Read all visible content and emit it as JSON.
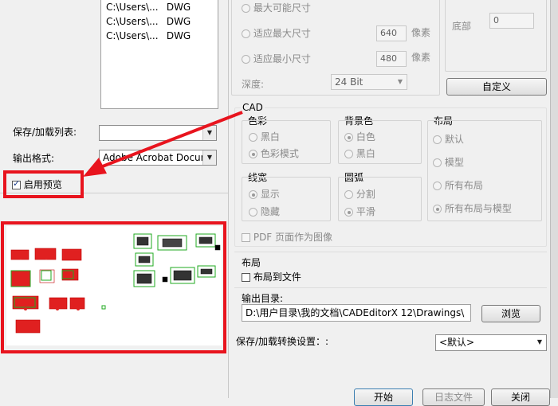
{
  "file_list": [
    {
      "path": "C:\\Users\\...",
      "type": "DWG"
    },
    {
      "path": "C:\\Users\\...",
      "type": "DWG"
    },
    {
      "path": "C:\\Users\\...",
      "type": "DWG"
    }
  ],
  "left": {
    "save_load_list_label": "保存/加载列表:",
    "save_load_list_value": "",
    "output_format_label": "输出格式:",
    "output_format_value": "Adobe Acrobat Document",
    "enable_preview_label": "启用预览",
    "enable_preview_checked": true
  },
  "size_options": {
    "max_possible": "最大可能尺寸",
    "fit_max": "适应最大尺寸",
    "fit_max_value": "640",
    "fit_min": "适应最小尺寸",
    "fit_min_value": "480",
    "unit": "像素",
    "depth_label": "深度:",
    "depth_value": "24 Bit",
    "bottom_label": "底部",
    "bottom_value": "0",
    "custom_button": "自定义"
  },
  "cad": {
    "title": "CAD",
    "color": {
      "title": "色彩",
      "options": [
        "黑白",
        "色彩模式"
      ],
      "selected": 1
    },
    "background": {
      "title": "背景色",
      "options": [
        "白色",
        "黑白"
      ],
      "selected": 0
    },
    "layout": {
      "title": "布局",
      "options": [
        "默认",
        "模型",
        "所有布局",
        "所有布局与模型"
      ],
      "selected": 3
    },
    "lineweight": {
      "title": "线宽",
      "options": [
        "显示",
        "隐藏"
      ],
      "selected": 0
    },
    "arc": {
      "title": "圆弧",
      "options": [
        "分割",
        "平滑"
      ],
      "selected": 1
    },
    "pdf_as_image": "PDF 页面作为图像"
  },
  "layout_section": {
    "title": "布局",
    "layout_to_file": "布局到文件"
  },
  "output_dir": {
    "label": "输出目录:",
    "value": "D:\\用户目录\\我的文档\\CADEditorX 12\\Drawings\\",
    "browse_button": "浏览"
  },
  "conversion_settings": {
    "label": "保存/加载转换设置：:",
    "value": "<默认>"
  },
  "bottom_buttons": {
    "start": "开始",
    "log": "日志文件",
    "close": "关闭"
  },
  "colors": {
    "annotation_red": "#e8141e"
  }
}
